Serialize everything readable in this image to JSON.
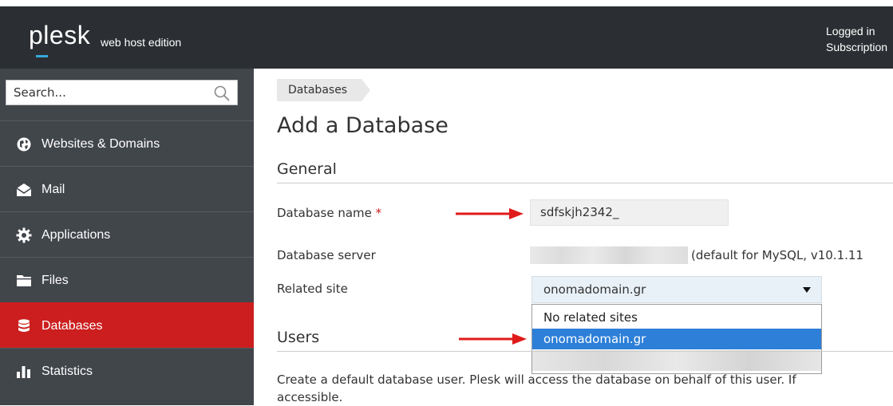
{
  "header": {
    "logo_word": "plesk",
    "logo_edition": "web host edition",
    "account_line1": "Logged in",
    "account_line2": "Subscription"
  },
  "sidebar": {
    "search_placeholder": "Search...",
    "items": [
      {
        "label": "Websites & Domains",
        "icon": "globe-icon",
        "active": false
      },
      {
        "label": "Mail",
        "icon": "mail-icon",
        "active": false
      },
      {
        "label": "Applications",
        "icon": "gear-icon",
        "active": false
      },
      {
        "label": "Files",
        "icon": "folder-icon",
        "active": false
      },
      {
        "label": "Databases",
        "icon": "database-icon",
        "active": true
      },
      {
        "label": "Statistics",
        "icon": "bar-chart-icon",
        "active": false
      }
    ]
  },
  "breadcrumb": {
    "label": "Databases"
  },
  "page": {
    "title": "Add a Database",
    "general_heading": "General",
    "users_heading": "Users",
    "users_description_line1": "Create a default database user. Plesk will access the database on behalf of this user. If",
    "users_description_line2": "accessible."
  },
  "form": {
    "database_name_label": "Database name",
    "required_marker": "*",
    "database_name_value": "sdfskjh2342_",
    "database_server_label": "Database server",
    "database_server_note": "(default for MySQL, v10.1.11",
    "related_site_label": "Related site",
    "related_site_value": "onomadomain.gr",
    "related_site_options": [
      "No related sites",
      "onomadomain.gr",
      ""
    ]
  },
  "colors": {
    "topbar": "#2b2f33",
    "sidebar": "#41464b",
    "active_item": "#cc1e1e",
    "highlight": "#2d7fd8",
    "arrow": "#e01b1b",
    "logo_accent": "#36a8de"
  }
}
